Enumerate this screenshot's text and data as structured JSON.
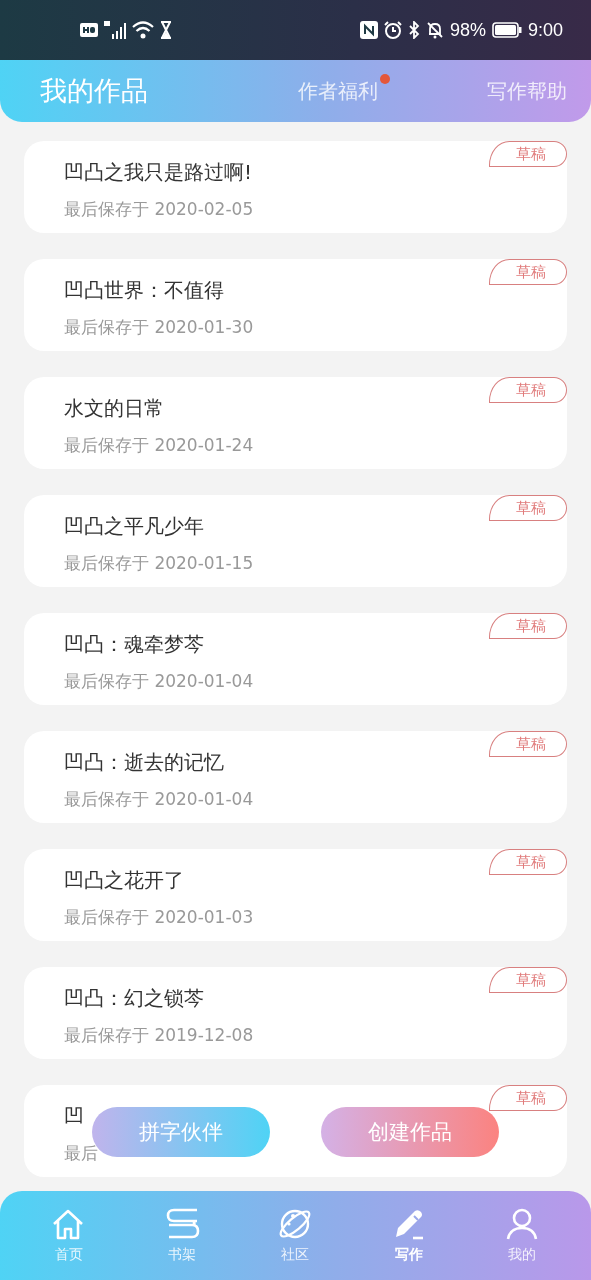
{
  "status_bar": {
    "battery": "98%",
    "time": "9:00"
  },
  "header": {
    "tabs": [
      {
        "label": "我的作品",
        "selected": true,
        "dot": false
      },
      {
        "label": "作者福利",
        "selected": false,
        "dot": true
      },
      {
        "label": "写作帮助",
        "selected": false,
        "dot": false
      }
    ]
  },
  "works": [
    {
      "title": "凹凸之我只是路过啊!",
      "saved": "最后保存于 2020-02-05",
      "tag": "草稿"
    },
    {
      "title": "凹凸世界：不值得",
      "saved": "最后保存于 2020-01-30",
      "tag": "草稿"
    },
    {
      "title": "水文的日常",
      "saved": "最后保存于 2020-01-24",
      "tag": "草稿"
    },
    {
      "title": "凹凸之平凡少年",
      "saved": "最后保存于 2020-01-15",
      "tag": "草稿"
    },
    {
      "title": "凹凸：魂牵梦芩",
      "saved": "最后保存于 2020-01-04",
      "tag": "草稿"
    },
    {
      "title": "凹凸：逝去的记忆",
      "saved": "最后保存于 2020-01-04",
      "tag": "草稿"
    },
    {
      "title": "凹凸之花开了",
      "saved": "最后保存于 2020-01-03",
      "tag": "草稿"
    },
    {
      "title": "凹凸：幻之锁芩",
      "saved": "最后保存于 2019-12-08",
      "tag": "草稿"
    },
    {
      "title": "凹",
      "saved": "最后",
      "tag": "草稿"
    }
  ],
  "floating_buttons": [
    {
      "label": "拼字伙伴",
      "kind": "partner"
    },
    {
      "label": "创建作品",
      "kind": "create"
    }
  ],
  "bottom_nav": [
    {
      "label": "首页",
      "selected": false
    },
    {
      "label": "书架",
      "selected": false
    },
    {
      "label": "社区",
      "selected": false
    },
    {
      "label": "写作",
      "selected": true
    },
    {
      "label": "我的",
      "selected": false
    }
  ]
}
